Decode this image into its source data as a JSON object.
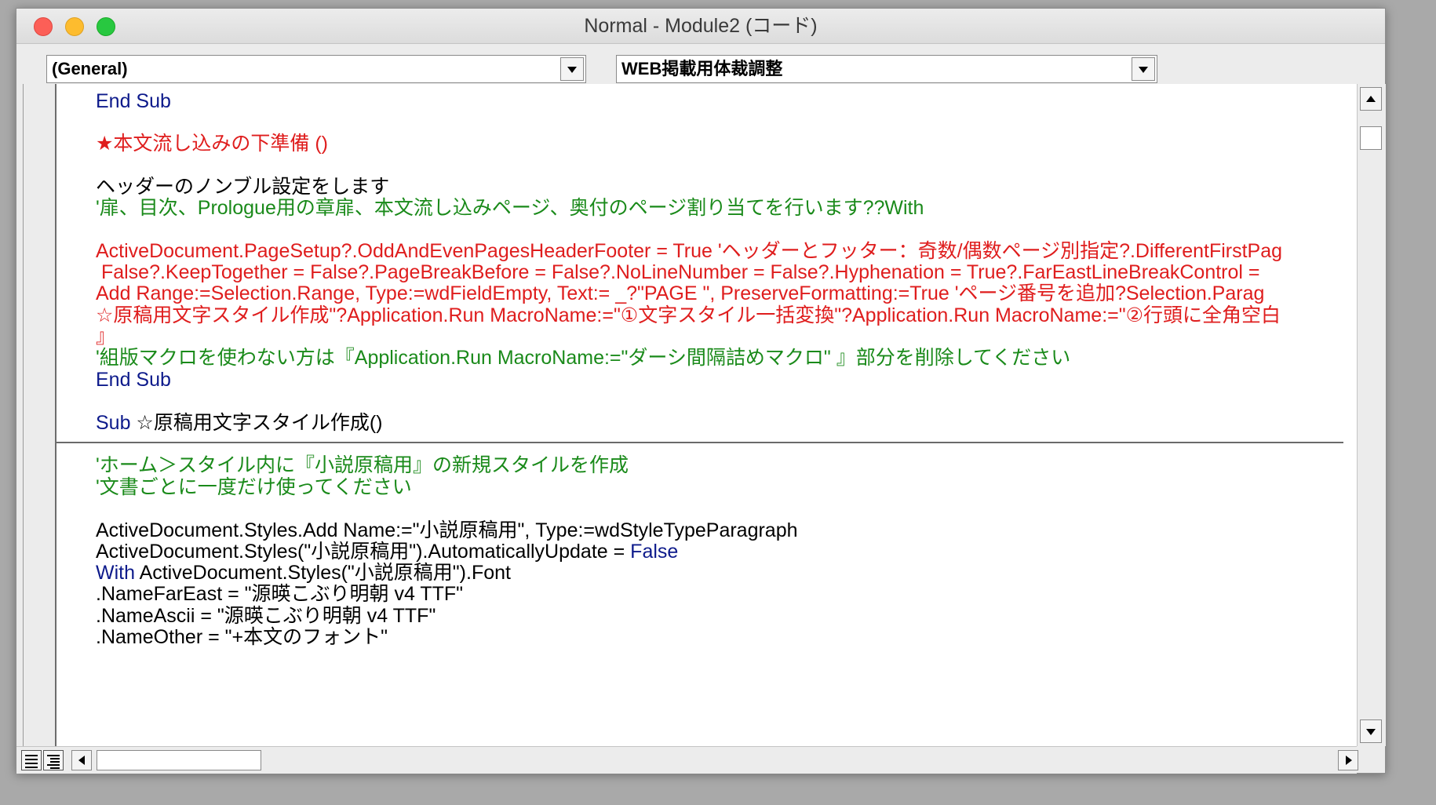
{
  "window": {
    "title": "Normal - Module2 (コード)"
  },
  "toolbar": {
    "object_dropdown": "(General)",
    "procedure_dropdown": "WEB掲載用体裁調整"
  },
  "code_lines": [
    {
      "text": "End Sub",
      "color": "blue"
    },
    {
      "text": "★本文流し込みの下準備 ()",
      "color": "red"
    },
    {
      "text": "ヘッダーのノンブル設定をします",
      "color": "black"
    },
    {
      "text": "'扉、目次、Prologue用の章扉、本文流し込みページ、奥付のページ割り当てを行います??With",
      "color": "green"
    },
    {
      "text": "ActiveDocument.PageSetup?.OddAndEvenPagesHeaderFooter = True 'ヘッダーとフッター：奇数/偶数ページ別指定?.DifferentFirstPag",
      "color": "red"
    },
    {
      "text": " False?.KeepTogether = False?.PageBreakBefore = False?.NoLineNumber = False?.Hyphenation = True?.FarEastLineBreakControl = ",
      "color": "red"
    },
    {
      "text": "Add Range:=Selection.Range, Type:=wdFieldEmpty, Text:= _?\"PAGE \", PreserveFormatting:=True 'ページ番号を追加?Selection.Parag",
      "color": "red"
    },
    {
      "text": "☆原稿用文字スタイル作成\"?Application.Run MacroName:=\"①文字スタイル一括変換\"?Application.Run MacroName:=\"②行頭に全角空白",
      "color": "red"
    },
    {
      "text": "』",
      "color": "red"
    },
    {
      "text": "'組版マクロを使わない方は『Application.Run MacroName:=\"ダーシ間隔詰めマクロ\" 』部分を削除してください",
      "color": "green"
    },
    {
      "text": "End Sub",
      "color": "blue"
    },
    {
      "text": "Sub ☆原稿用文字スタイル作成()",
      "color": "mixed_sub"
    },
    {
      "text": "'ホーム＞スタイル内に『小説原稿用』の新規スタイルを作成",
      "color": "green"
    },
    {
      "text": "'文書ごとに一度だけ使ってください",
      "color": "green"
    },
    {
      "text": "ActiveDocument.Styles.Add Name:=\"小説原稿用\", Type:=wdStyleTypeParagraph",
      "color": "black"
    },
    {
      "text": "ActiveDocument.Styles(\"小説原稿用\").AutomaticallyUpdate = False",
      "color": "mixed_false"
    },
    {
      "text": "With ActiveDocument.Styles(\"小説原稿用\").Font",
      "color": "mixed_with"
    },
    {
      "text": ".NameFarEast = \"源暎こぶり明朝 v4 TTF\"",
      "color": "black"
    },
    {
      "text": ".NameAscii = \"源暎こぶり明朝 v4 TTF\"",
      "color": "black"
    },
    {
      "text": ".NameOther = \"+本文のフォント\"",
      "color": "black"
    }
  ],
  "tokens": {
    "sub_kw": "Sub",
    "sub_rest": " ☆原稿用文字スタイル作成()",
    "false_pre": "ActiveDocument.Styles(\"小説原稿用\").AutomaticallyUpdate = ",
    "false_kw": "False",
    "with_kw": "With",
    "with_rest": " ActiveDocument.Styles(\"小説原稿用\").Font"
  },
  "colors": {
    "keyword_blue": "#0d1a8b",
    "error_red": "#df1d1d",
    "comment_green": "#1a8a1a"
  }
}
